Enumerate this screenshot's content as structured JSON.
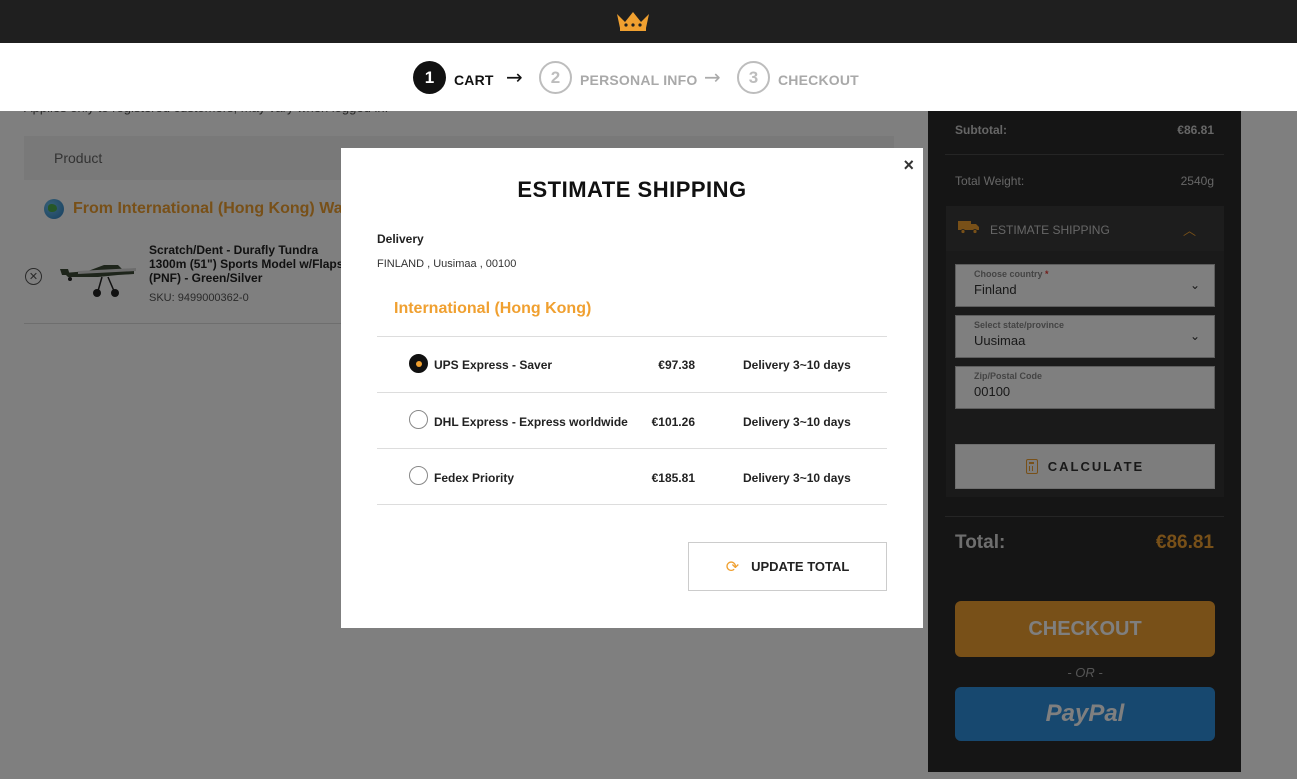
{
  "steps": [
    {
      "num": "1",
      "label": "CART"
    },
    {
      "num": "2",
      "label": "PERSONAL INFO"
    },
    {
      "num": "3",
      "label": "CHECKOUT"
    }
  ],
  "cart": {
    "applies_note": "Applies only to registered customers, may vary when logged in.",
    "header_product": "Product",
    "warehouse": "From International (Hong Kong) Ware",
    "item": {
      "name": "Scratch/Dent - Durafly Tundra 1300m (51\") Sports Model w/Flaps (PNF) - Green/Silver",
      "sku": "SKU: 9499000362-0"
    }
  },
  "sidebar": {
    "subtotal_label": "Subtotal:",
    "subtotal_value": "€86.81",
    "weight_label": "Total Weight:",
    "weight_value": "2540g",
    "estimate_title": "ESTIMATE SHIPPING",
    "country_label": "Choose country",
    "country_required": "*",
    "country_value": "Finland",
    "state_label": "Select state/province",
    "state_value": "Uusimaa",
    "zip_label": "Zip/Postal Code",
    "zip_value": "00100",
    "calculate_label": "CALCULATE",
    "total_label": "Total:",
    "total_value": "€86.81",
    "checkout_label": "CHECKOUT",
    "or_text": "- OR -",
    "paypal_label": "PayPal"
  },
  "modal": {
    "title": "ESTIMATE SHIPPING",
    "close": "×",
    "delivery_label": "Delivery",
    "delivery_address": "FINLAND , Uusimaa , 00100",
    "region": "International (Hong Kong)",
    "options": [
      {
        "name": "UPS Express - Saver",
        "price": "€97.38",
        "days": "Delivery 3~10 days",
        "selected": true
      },
      {
        "name": "DHL Express - Express worldwide",
        "price": "€101.26",
        "days": "Delivery 3~10 days",
        "selected": false
      },
      {
        "name": "Fedex Priority",
        "price": "€185.81",
        "days": "Delivery 3~10 days",
        "selected": false
      }
    ],
    "update_label": "UPDATE TOTAL"
  },
  "colors": {
    "accent": "#f0a030",
    "dark": "#1f1f1f",
    "paypal": "#2f90de"
  }
}
